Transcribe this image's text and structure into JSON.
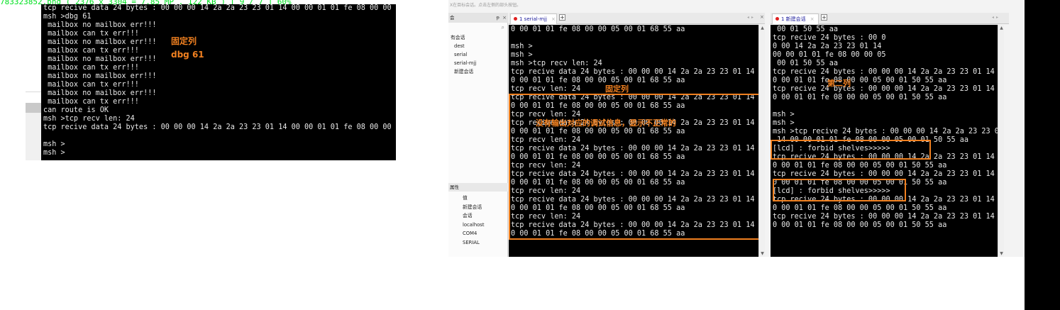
{
  "caption": "783323852.png ( 2376 x 3304 = 7.85 MP , 122 KB ) [ 9 / 7 ] 60%",
  "left_terminal": {
    "lines": [
      "tcp recive data 24 bytes : 00 00 00 14 2a 2a 23 23 01 14 00 00 01 01 fe 08 00 00 05",
      "msh >dbg 61",
      " mailbox no mailbox err!!!",
      " mailbox can tx err!!!",
      " mailbox no mailbox err!!!",
      " mailbox can tx err!!!",
      " mailbox no mailbox err!!!",
      " mailbox can tx err!!!",
      " mailbox no mailbox err!!!",
      " mailbox can tx err!!!",
      " mailbox no mailbox err!!!",
      " mailbox can tx err!!!",
      "can route is OK",
      "msh >tcp recv len: 24",
      "tcp recive data 24 bytes : 00 00 00 14 2a 2a 23 23 01 14 00 00 01 01 fe 08 00 00 05",
      "",
      "msh >",
      "msh >"
    ],
    "annotations": {
      "fixed_column": "固定列",
      "dbg": "dbg 61"
    }
  },
  "app": {
    "hint": "X在目标会话。点击左侧的部头按钮。",
    "session_panel": {
      "title": "会",
      "pin": "ᵽ",
      "close": "×",
      "search_icon": "search-icon",
      "items": [
        {
          "label": "有会话",
          "child": false
        },
        {
          "label": "dest",
          "child": true
        },
        {
          "label": "serial",
          "child": true
        },
        {
          "label": "serial-mjj",
          "child": true
        },
        {
          "label": "新建会话",
          "child": true
        }
      ]
    },
    "properties_panel": {
      "title": "属性",
      "items": [
        "值",
        "新建会话",
        "会话",
        "localhost",
        "COM4",
        "SERIAL"
      ]
    },
    "left_pane": {
      "tab_label": "1 serial-mjj",
      "tab_close": "×",
      "plus": "+",
      "nav": "◂▸",
      "close": "×",
      "lines": [
        "0 00 01 01 fe 08 00 00 05 00 01 68 55 aa",
        "",
        "msh >",
        "msh >",
        "msh >tcp recv len: 24",
        "tcp recive data 24 bytes : 00 00 00 14 2a 2a 23 23 01 14 0",
        "0 00 01 01 fe 08 00 00 05 00 01 68 55 aa",
        "tcp recv len: 24",
        "tcp recive data 24 bytes : 00 00 00 14 2a 2a 23 23 01 14 0",
        "0 00 01 01 fe 08 00 00 05 00 01 68 55 aa",
        "tcp recv len: 24",
        "tcp recive data 24 bytes : 00 00 00 14 2a 2a 23 23 01 14 0",
        "0 00 01 01 fe 08 00 00 05 00 01 68 55 aa",
        "tcp recv len: 24",
        "tcp recive data 24 bytes : 00 00 00 14 2a 2a 23 23 01 14 0",
        "0 00 01 01 fe 08 00 00 05 00 01 68 55 aa",
        "tcp recv len: 24",
        "tcp recive data 24 bytes : 00 00 00 14 2a 2a 23 23 01 14 0",
        "0 00 01 01 fe 08 00 00 05 00 01 68 55 aa",
        "tcp recv len: 24",
        "tcp recive data 24 bytes : 00 00 00 14 2a 2a 23 23 01 14 0",
        "0 00 01 01 fe 08 00 00 05 00 01 68 55 aa",
        "tcp recv len: 24",
        "tcp recive data 24 bytes : 00 00 00 14 2a 2a 23 23 01 14 0",
        "0 00 01 01 fe 08 00 00 05 00 01 68 55 aa"
      ],
      "annotations": {
        "fixed_column": "固定列",
        "no_debug_info": "没有输出对应的调试信息，显示不正常的"
      }
    },
    "right_pane": {
      "tab_label": "1 新建会话",
      "tab_close": "×",
      "plus": "+",
      "nav": "◂▸",
      "lines": [
        " 00 01 50 55 aa",
        "tcp recive 24 bytes : 00 0",
        "0 00 14 2a 2a 23 23 01 14",
        "00 00 01 01 fe 08 00 00 05",
        " 00 01 50 55 aa",
        "tcp recive 24 bytes : 00 00 00 14 2a 2a 23 23 01 14 0",
        "0 00 01 01 fe 08 00 00 05 00 01 50 55 aa",
        "tcp recive 24 bytes : 00 00 00 14 2a 2a 23 23 01 14 0",
        "0 00 01 01 fe 08 00 00 05 00 01 50 55 aa",
        "",
        "msh >",
        "msh >",
        "msh >tcp recive 24 bytes : 00 00 00 14 2a 2a 23 23 01",
        " 14 00 00 01 01 fe 08 00 00 05 00 01 50 55 aa",
        "[lcd] : forbid shelves>>>>>",
        "tcp recive 24 bytes : 00 00 00 14 2a 2a 23 23 01 14 0",
        "0 00 01 01 fe 08 00 00 05 00 01 50 55 aa",
        "tcp recive 24 bytes : 00 00 00 14 2a 2a 23 23 01 14 0",
        "0 00 01 01 fe 08 00 00 05 00 01 50 55 aa",
        "[lcd] : forbid shelves>>>>>",
        "tcp recive 24 bytes : 00 00 00 14 2a 2a 23 23 01 14 0",
        "0 00 01 01 fe 08 00 00 05 00 01 50 55 aa",
        "tcp recive 24 bytes : 00 00 00 14 2a 2a 23 23 01 14 0",
        "0 00 01 01 fe 08 00 00 05 00 01 50 55 aa"
      ],
      "annotations": {
        "second_column": "第二列"
      }
    }
  },
  "colors": {
    "annotation": "#f08020",
    "terminal_bg": "#000000",
    "terminal_fg": "#e8e8e8",
    "tab_dot": "#e02020",
    "caption": "#00e020"
  }
}
